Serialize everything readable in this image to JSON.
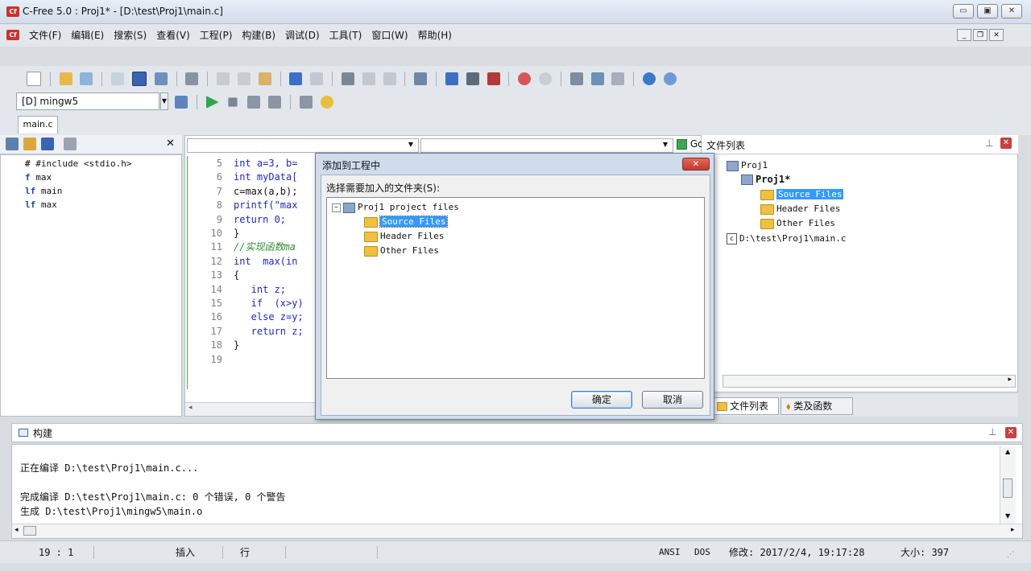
{
  "window": {
    "title": "C-Free 5.0 : Proj1* - [D:\\test\\Proj1\\main.c]",
    "icon_text": "Cf"
  },
  "menu": [
    "文件(F)",
    "编辑(E)",
    "搜索(S)",
    "查看(V)",
    "工程(P)",
    "构建(B)",
    "调试(D)",
    "工具(T)",
    "窗口(W)",
    "帮助(H)"
  ],
  "compiler_select": {
    "value": "[D] mingw5"
  },
  "editor_tab": "main.c",
  "symbols": [
    "#include <stdio.h>",
    "max",
    "main",
    "max"
  ],
  "editor": {
    "lines": [
      {
        "n": "5",
        "t": "int a=3, b="
      },
      {
        "n": "6",
        "t": "int myData["
      },
      {
        "n": "7",
        "t": "c=max(a,b);"
      },
      {
        "n": "8",
        "t": "printf(\"max"
      },
      {
        "n": "9",
        "t": "return 0;"
      },
      {
        "n": "10",
        "t": "}"
      },
      {
        "n": "11",
        "t": "//实现函数ma"
      },
      {
        "n": "12",
        "t": "int  max(in"
      },
      {
        "n": "13",
        "t": "{"
      },
      {
        "n": "14",
        "t": "   int z;"
      },
      {
        "n": "15",
        "t": "   if  (x>y)"
      },
      {
        "n": "16",
        "t": "   else z=y;"
      },
      {
        "n": "17",
        "t": "   return z;"
      },
      {
        "n": "18",
        "t": "}"
      },
      {
        "n": "19",
        "t": ""
      }
    ],
    "go_label": "Go"
  },
  "dialog": {
    "title": "添加到工程中",
    "prompt": "选择需要加入的文件夹(S):",
    "root": "Proj1 project files",
    "folders": [
      "Source Files",
      "Header Files",
      "Other Files"
    ],
    "ok": "确定",
    "cancel": "取消"
  },
  "file_list": {
    "title": "文件列表",
    "root": "Proj1",
    "project": "Proj1*",
    "folders": [
      "Source Files",
      "Header Files",
      "Other Files"
    ],
    "file": "D:\\test\\Proj1\\main.c",
    "tabs": [
      "文件列表",
      "类及函数"
    ]
  },
  "build": {
    "title": "构建",
    "lines": [
      "正在编译 D:\\test\\Proj1\\main.c...",
      "",
      "完成编译 D:\\test\\Proj1\\main.c: 0 个错误, 0 个警告",
      "生成 D:\\test\\Proj1\\mingw5\\main.o"
    ]
  },
  "status": {
    "position": "19 : 1",
    "mode": "插入",
    "unit": "行",
    "encoding": "ANSI",
    "lineend": "DOS",
    "modified": "修改: 2017/2/4, 19:17:28",
    "size": "大小: 397"
  },
  "colors": {
    "accent": "#3c7fd6",
    "selection": "#3399ff"
  }
}
